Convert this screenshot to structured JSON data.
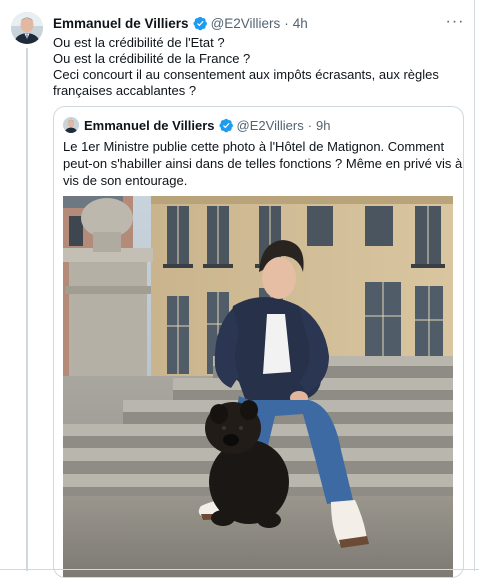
{
  "tweet": {
    "author_name": "Emmanuel de Villiers",
    "author_handle": "@E2Villiers",
    "separator": "·",
    "time": "4h",
    "more_label": "···",
    "lines": [
      "Ou est la crédibilité de l'Etat ?",
      "Ou est la crédibilité de la France ?",
      "Ceci concourt il au consentement aux impôts écrasants, aux règles",
      "françaises accablantes ?"
    ]
  },
  "quoted_tweet": {
    "author_name": "Emmanuel de Villiers",
    "author_handle": "@E2Villiers",
    "separator": "·",
    "time": "9h",
    "lines": [
      "Le 1er Ministre publie cette photo à l'Hôtel de Matignon. Comment",
      "peut-on s'habiller ainsi dans de telles fonctions ? Même en privé vis à",
      "vis de son entourage."
    ]
  },
  "colors": {
    "verified_blue": "#1d9bf0",
    "text_primary": "#0f1419",
    "text_secondary": "#536471",
    "border": "#cfd9de"
  },
  "icons": {
    "verified": "verified-badge-icon",
    "more": "more-options-icon"
  }
}
